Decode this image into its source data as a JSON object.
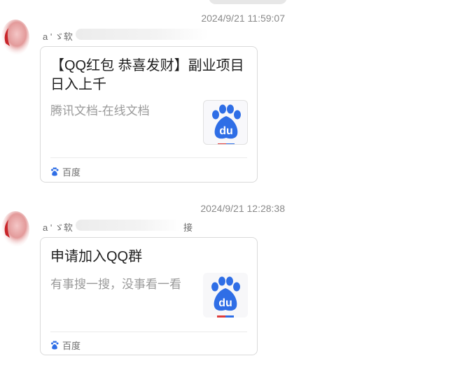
{
  "colors": {
    "baidu_blue": "#2f6ee6",
    "baidu_red": "#de3b3b",
    "card_border": "#dadada"
  },
  "messages": [
    {
      "timestamp": "2024/9/21 11:59:07",
      "sender": "a ' ゞ软",
      "card": {
        "title": "【QQ红包 恭喜发财】副业项目日入上千",
        "description": "腾讯文档-在线文档",
        "thumbnail_icon": "baidu-paw-icon",
        "thumbnail_text": "du",
        "source_icon": "baidu-paw-icon",
        "source_label": "百度"
      }
    },
    {
      "timestamp": "2024/9/21 12:28:38",
      "sender": "a ' ゞ软",
      "sender_tail": "接",
      "card": {
        "title": "申请加入QQ群",
        "description": "有事搜一搜，没事看一看",
        "thumbnail_icon": "baidu-paw-icon",
        "thumbnail_text": "du",
        "source_icon": "baidu-paw-icon",
        "source_label": "百度"
      }
    }
  ]
}
